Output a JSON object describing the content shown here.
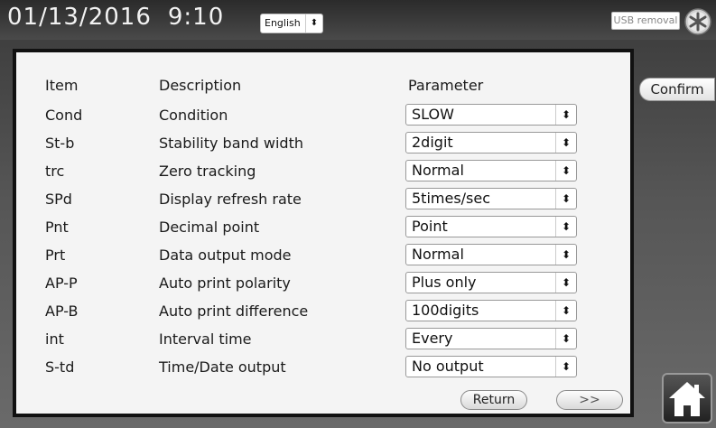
{
  "header": {
    "date": "01/13/2016",
    "time": "9:10",
    "language": "English",
    "usb_label": "USB removal"
  },
  "side": {
    "confirm_label": "Confirm"
  },
  "table": {
    "head": {
      "item": "Item",
      "description": "Description",
      "parameter": "Parameter"
    },
    "rows": [
      {
        "item": "Cond",
        "description": "Condition",
        "value": "SLOW"
      },
      {
        "item": "St-b",
        "description": "Stability band width",
        "value": "2digit"
      },
      {
        "item": "trc",
        "description": "Zero tracking",
        "value": "Normal"
      },
      {
        "item": "SPd",
        "description": "Display refresh rate",
        "value": "5times/sec"
      },
      {
        "item": "Pnt",
        "description": "Decimal point",
        "value": "Point"
      },
      {
        "item": "Prt",
        "description": "Data output mode",
        "value": "Normal"
      },
      {
        "item": "AP-P",
        "description": "Auto print polarity",
        "value": "Plus only"
      },
      {
        "item": "AP-B",
        "description": "Auto print difference",
        "value": "100digits"
      },
      {
        "item": "int",
        "description": "Interval time",
        "value": "Every"
      },
      {
        "item": "S-td",
        "description": "Time/Date output",
        "value": "No output"
      }
    ]
  },
  "footer": {
    "return_label": "Return",
    "next_label": ">>"
  },
  "icons": {
    "usb": "usb-removal-icon",
    "home": "home-icon",
    "select_arrow": "up-down-arrow-icon"
  },
  "select_arrow_glyph": "⬍"
}
